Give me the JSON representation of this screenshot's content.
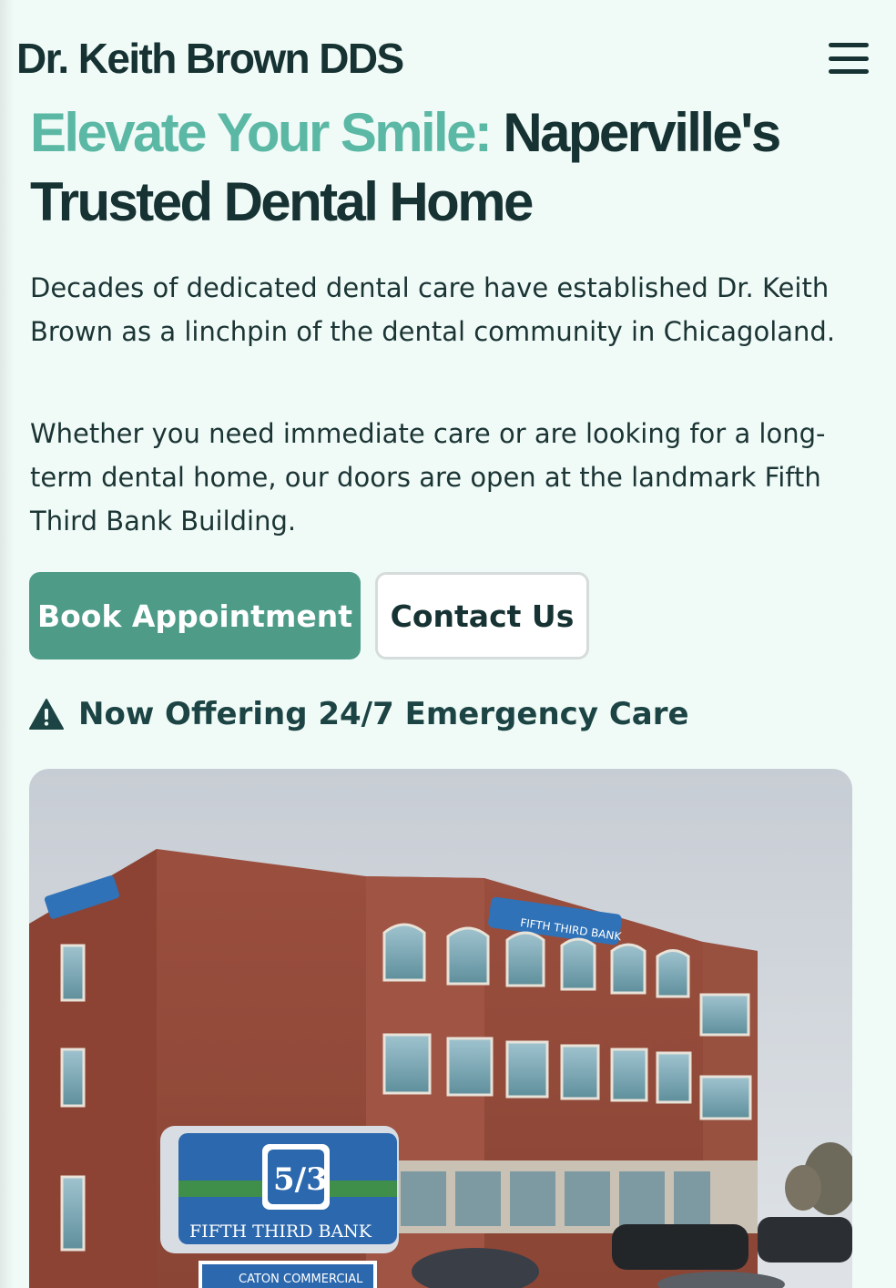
{
  "header": {
    "title": "Dr. Keith Brown DDS",
    "menu_icon": "hamburger-menu-icon"
  },
  "hero": {
    "title_accent": "Elevate Your Smile:",
    "title_rest": " Naperville's Trusted Dental Home",
    "paragraph_1": "Decades of dedicated dental care have established Dr. Keith Brown as a linchpin of the dental community in Chicagoland.",
    "paragraph_2": "Whether you need immediate care or are looking for a long-term dental home, our doors are open at the landmark Fifth Third Bank Building.",
    "book_label": "Book Appointment",
    "contact_label": "Contact Us",
    "notice_icon": "warning-triangle-icon",
    "notice_text": "Now Offering 24/7 Emergency Care"
  },
  "photo": {
    "building_sign": "FIFTH THIRD BANK",
    "monument_logo": "5/3",
    "monument_text": "FIFTH THIRD BANK",
    "monument_sub": "CATON COMMERCIAL"
  },
  "colors": {
    "accent": "#5bb8a5",
    "button_primary": "#4e9b88",
    "background": "#f0fbf7",
    "text_dark": "#163232"
  }
}
